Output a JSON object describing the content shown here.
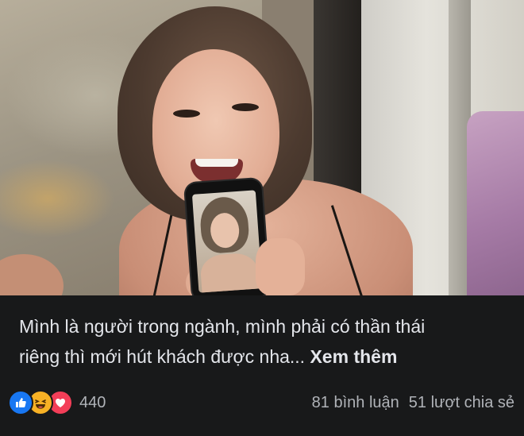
{
  "post": {
    "caption_line1": "Mình là người trong ngành, mình phải có thần thái",
    "caption_line2": "riêng thì mới hút khách được nha...",
    "see_more_label": "Xem thêm"
  },
  "footer": {
    "reaction_icons": [
      "like-icon",
      "haha-icon",
      "love-icon"
    ],
    "reaction_count": "440",
    "comments": "81 bình luận",
    "shares": "51 lượt chia sẻ"
  },
  "colors": {
    "background": "#18191a",
    "text": "#e4e6eb",
    "muted_text": "#b0b3b8",
    "like_blue": "#1877f2",
    "haha_yellow": "#f7b125",
    "love_red": "#f33e58"
  }
}
